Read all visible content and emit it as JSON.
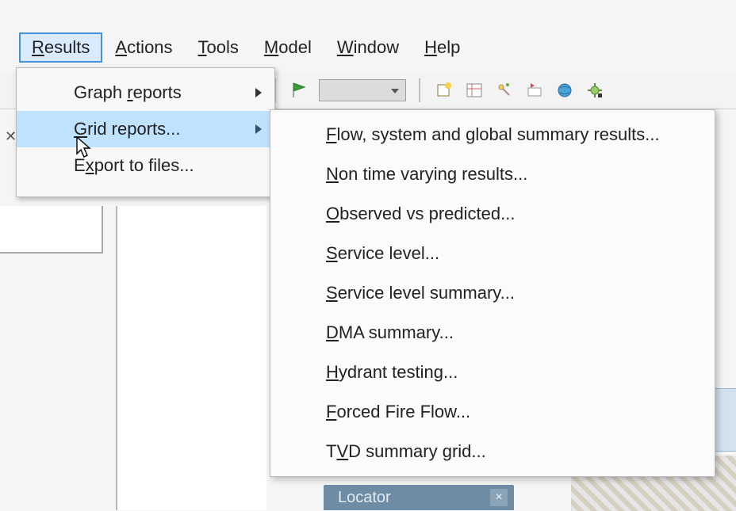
{
  "menubar": {
    "results": {
      "pre": "",
      "u": "R",
      "post": "esults"
    },
    "actions": {
      "pre": "",
      "u": "A",
      "post": "ctions"
    },
    "tools": {
      "pre": "",
      "u": "T",
      "post": "ools"
    },
    "model": {
      "pre": "",
      "u": "M",
      "post": "odel"
    },
    "window": {
      "pre": "",
      "u": "W",
      "post": "indow"
    },
    "help": {
      "pre": "",
      "u": "H",
      "post": "elp"
    }
  },
  "dropdown": {
    "graph": {
      "pre": "Graph ",
      "u": "r",
      "post": "eports"
    },
    "grid": {
      "pre": "",
      "u": "G",
      "post": "rid reports..."
    },
    "export": {
      "pre": "E",
      "u": "x",
      "post": "port to files..."
    }
  },
  "submenu": {
    "flow": {
      "pre": "",
      "u": "F",
      "post": "low, system and global summary results..."
    },
    "nontime": {
      "pre": "",
      "u": "N",
      "post": "on time varying results..."
    },
    "obs": {
      "pre": "",
      "u": "O",
      "post": "bserved vs predicted..."
    },
    "svc": {
      "pre": "",
      "u": "S",
      "post": "ervice level..."
    },
    "svcsum": {
      "pre": "",
      "u": "S",
      "post": "ervice level summary..."
    },
    "dma": {
      "pre": "",
      "u": "D",
      "post": "MA summary..."
    },
    "hydrant": {
      "pre": "",
      "u": "H",
      "post": "ydrant testing..."
    },
    "fff": {
      "pre": "",
      "u": "F",
      "post": "orced Fire Flow..."
    },
    "tvd": {
      "pre": "T",
      "u": "V",
      "post": "D summary grid..."
    }
  },
  "locator": {
    "label": "Locator"
  },
  "close_x": "×"
}
